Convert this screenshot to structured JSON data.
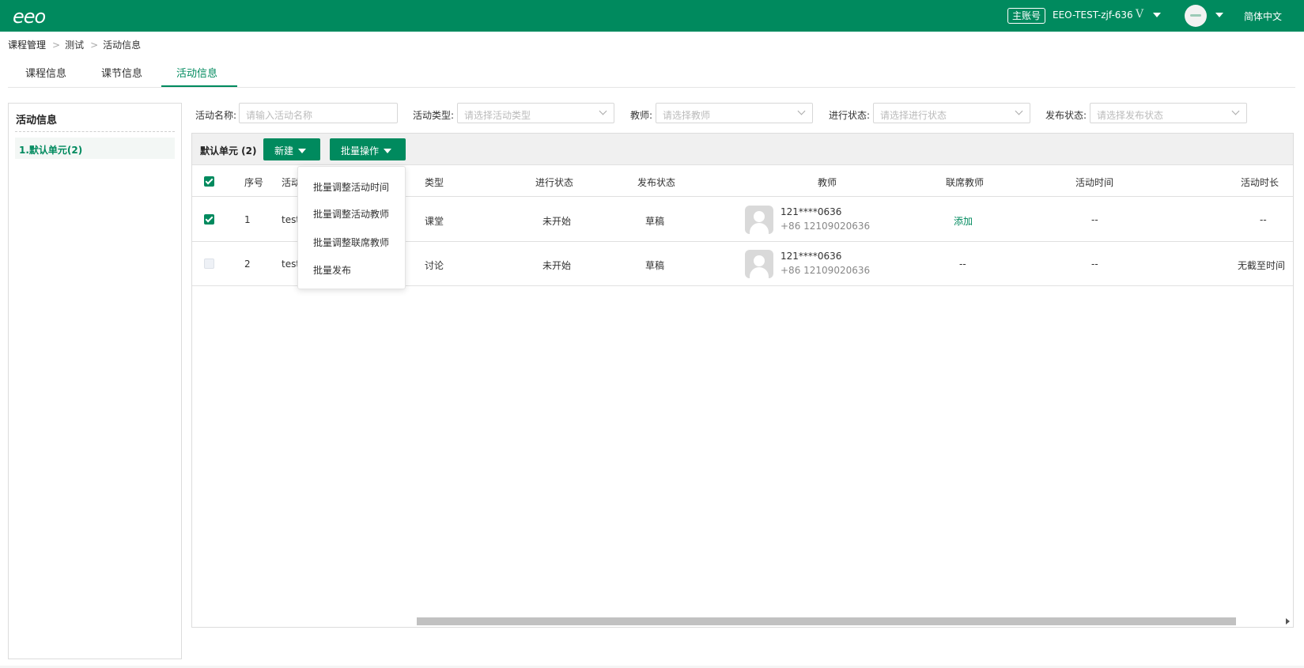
{
  "header": {
    "logo": "eeo",
    "account_badge": "主账号",
    "account_name": "EEO-TEST-zjf-636",
    "vip_icon": "V",
    "language": "简体中文",
    "bg_color": "#008a5e"
  },
  "breadcrumb": [
    "课程管理",
    "测试",
    "活动信息"
  ],
  "breadcrumb_sep": ">",
  "tabs": [
    "课程信息",
    "课节信息",
    "活动信息"
  ],
  "active_tab": "活动信息",
  "sidebar": {
    "title": "活动信息",
    "items": [
      {
        "label": "1.默认单元(2)"
      }
    ]
  },
  "filters": {
    "name_label": "活动名称:",
    "name_placeholder": "请输入活动名称",
    "type_label": "活动类型:",
    "type_placeholder": "请选择活动类型",
    "teacher_label": "教师:",
    "teacher_placeholder": "请选择教师",
    "progress_label": "进行状态:",
    "progress_placeholder": "请选择进行状态",
    "publish_label": "发布状态:",
    "publish_placeholder": "请选择发布状态"
  },
  "toolbar": {
    "unit_label": "默认单元 (2)",
    "new_button": "新建",
    "batch_button": "批量操作"
  },
  "table": {
    "headers": [
      "序号",
      "活动",
      "类型",
      "进行状态",
      "发布状态",
      "教师",
      "联席教师",
      "活动时间",
      "活动时长"
    ],
    "rows": [
      {
        "checked": true,
        "index": "1",
        "name": "test",
        "type": "课堂",
        "progress": "未开始",
        "publish": "草稿",
        "teacher_name": "121****0636",
        "teacher_phone": "+86 12109020636",
        "co_teacher": "添加",
        "time": "--",
        "duration": "--"
      },
      {
        "checked": false,
        "index": "2",
        "name": "test",
        "type": "讨论",
        "progress": "未开始",
        "publish": "草稿",
        "teacher_name": "121****0636",
        "teacher_phone": "+86 12109020636",
        "co_teacher": "--",
        "time": "--",
        "duration": "无截至时间"
      }
    ]
  },
  "batch_menu": [
    "批量调整活动时间",
    "批量调整活动教师",
    "批量调整联席教师",
    "批量发布"
  ]
}
